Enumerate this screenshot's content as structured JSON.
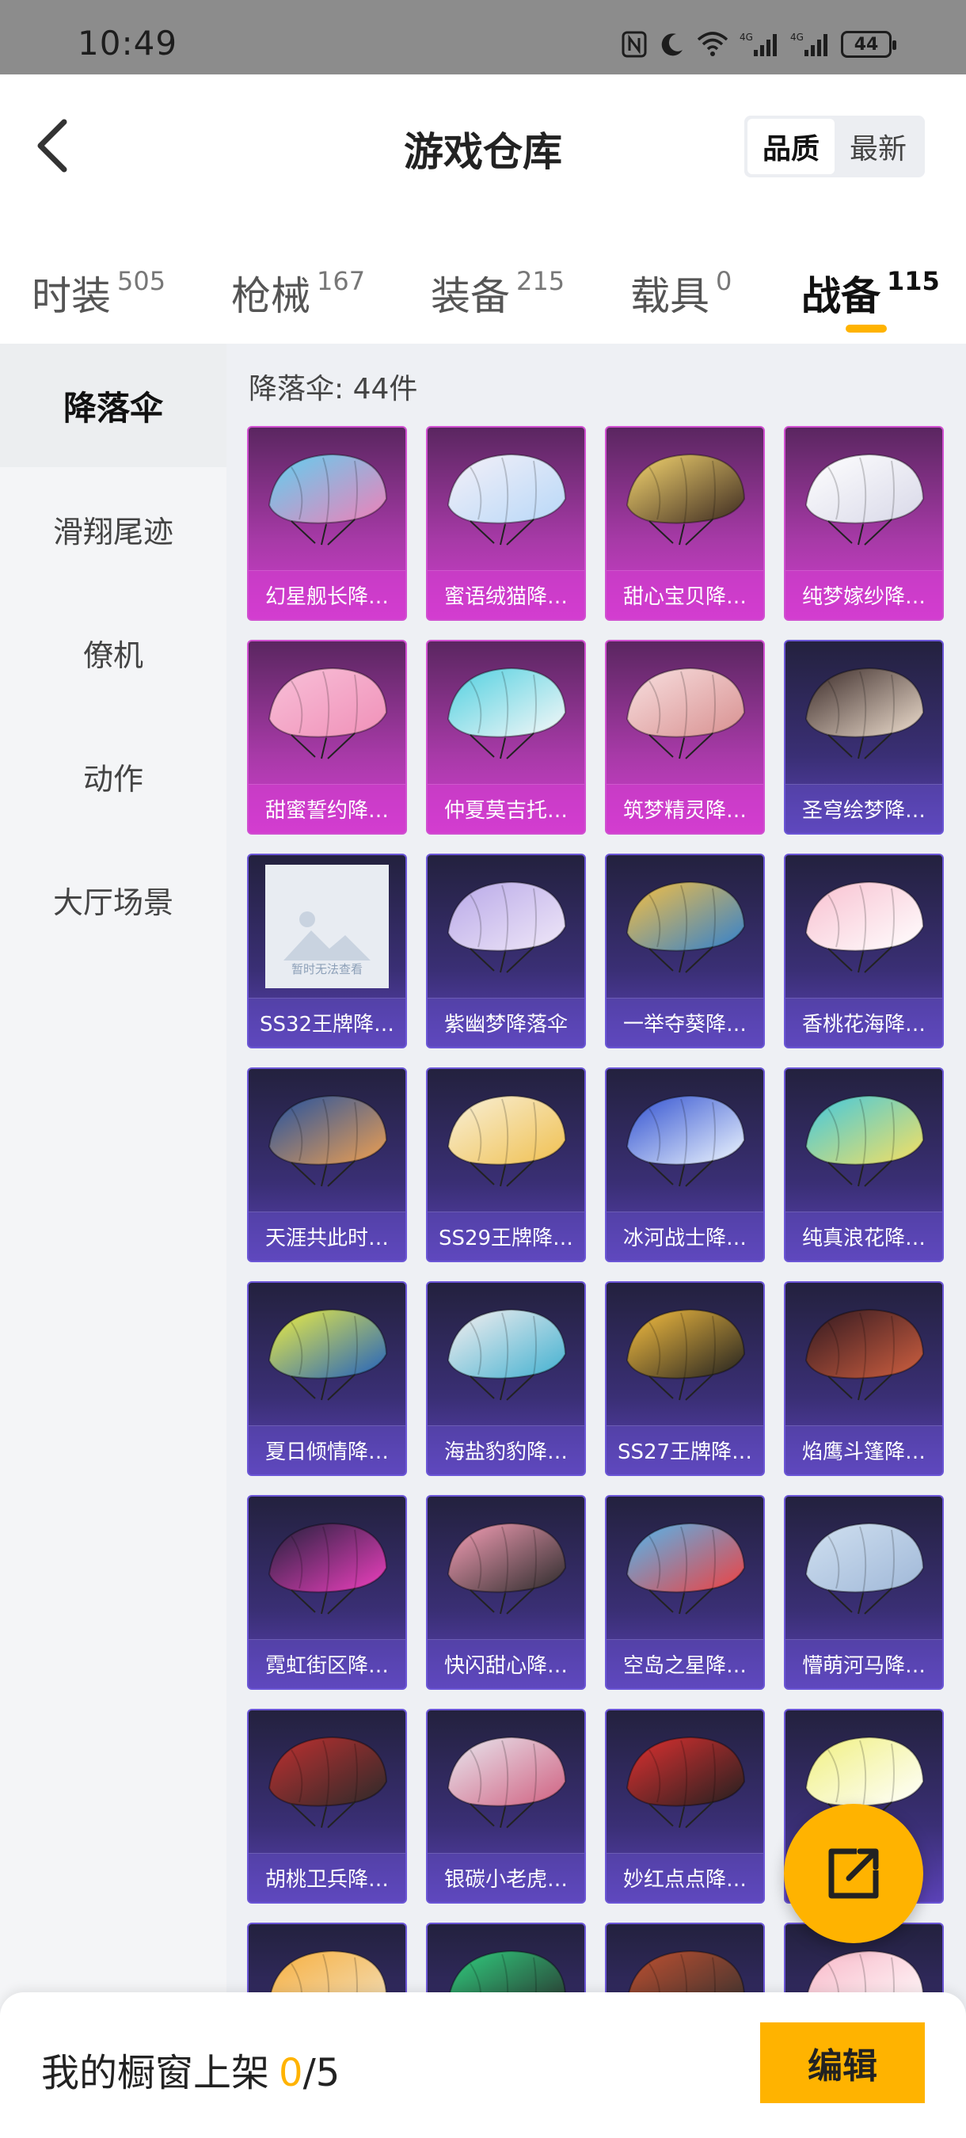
{
  "status_bar": {
    "time": "10:49",
    "battery": "44",
    "network": "4G"
  },
  "header": {
    "title": "游戏仓库",
    "sort_options": [
      "品质",
      "最新"
    ],
    "sort_active": "品质"
  },
  "tabs": [
    {
      "label": "时装",
      "count": "505"
    },
    {
      "label": "枪械",
      "count": "167"
    },
    {
      "label": "装备",
      "count": "215"
    },
    {
      "label": "载具",
      "count": "0"
    },
    {
      "label": "战备",
      "count": "115",
      "active": true
    }
  ],
  "sidebar": {
    "items": [
      "降落伞",
      "滑翔尾迹",
      "僚机",
      "动作",
      "大厅场景"
    ],
    "active": "降落伞"
  },
  "main": {
    "count_label": "降落伞: 44件",
    "placeholder_text": "暂时无法查看",
    "items": [
      {
        "name": "幻星舰长降…",
        "tier": "pink",
        "colors": [
          "#5fd0f0",
          "#f080b8"
        ]
      },
      {
        "name": "蜜语绒猫降…",
        "tier": "pink",
        "colors": [
          "#f4f0f8",
          "#b8d8f8"
        ]
      },
      {
        "name": "甜心宝贝降…",
        "tier": "pink",
        "colors": [
          "#f8d870",
          "#3a2820"
        ]
      },
      {
        "name": "纯梦嫁纱降…",
        "tier": "pink",
        "colors": [
          "#ffffff",
          "#d8d8e8"
        ]
      },
      {
        "name": "甜蜜誓约降…",
        "tier": "pink",
        "colors": [
          "#f8c0d8",
          "#f090b8"
        ]
      },
      {
        "name": "仲夏莫吉托…",
        "tier": "pink",
        "colors": [
          "#50d0e0",
          "#f8f8f8"
        ]
      },
      {
        "name": "筑梦精灵降…",
        "tier": "pink",
        "colors": [
          "#f8e0e0",
          "#d89090"
        ]
      },
      {
        "name": "圣穹绘梦降…",
        "tier": "purple",
        "colors": [
          "#3a2a28",
          "#f0e0d0"
        ]
      },
      {
        "name": "SS32王牌降…",
        "tier": "purple",
        "colors": [],
        "placeholder": true
      },
      {
        "name": "紫幽梦降落伞",
        "tier": "purple",
        "colors": [
          "#b8a8e8",
          "#f0e8f8"
        ]
      },
      {
        "name": "一举夺葵降…",
        "tier": "purple",
        "colors": [
          "#f8c040",
          "#3080d0"
        ]
      },
      {
        "name": "香桃花海降…",
        "tier": "purple",
        "colors": [
          "#f8c0d0",
          "#ffffff"
        ]
      },
      {
        "name": "天涯共此时…",
        "tier": "purple",
        "colors": [
          "#2050a0",
          "#f0a050"
        ]
      },
      {
        "name": "SS29王牌降…",
        "tier": "purple",
        "colors": [
          "#f8f0d8",
          "#f0c050"
        ]
      },
      {
        "name": "冰河战士降…",
        "tier": "purple",
        "colors": [
          "#3050d0",
          "#f0f8ff"
        ]
      },
      {
        "name": "纯真浪花降…",
        "tier": "purple",
        "colors": [
          "#40c8e0",
          "#f8e060"
        ]
      },
      {
        "name": "夏日倾情降…",
        "tier": "purple",
        "colors": [
          "#f0f040",
          "#2060c0"
        ]
      },
      {
        "name": "海盐豹豹降…",
        "tier": "purple",
        "colors": [
          "#f8f0f0",
          "#40b0d0"
        ]
      },
      {
        "name": "SS27王牌降…",
        "tier": "purple",
        "colors": [
          "#f8c040",
          "#202020"
        ]
      },
      {
        "name": "焰鹰斗篷降…",
        "tier": "purple",
        "colors": [
          "#301820",
          "#d06040"
        ]
      },
      {
        "name": "霓虹街区降…",
        "tier": "purple",
        "colors": [
          "#20203a",
          "#f040c0"
        ]
      },
      {
        "name": "快闪甜心降…",
        "tier": "purple",
        "colors": [
          "#f8a0b8",
          "#2a2a2a"
        ]
      },
      {
        "name": "空岛之星降…",
        "tier": "purple",
        "colors": [
          "#50b8f0",
          "#f04040"
        ]
      },
      {
        "name": "懵萌河马降…",
        "tier": "purple",
        "colors": [
          "#d0e0f0",
          "#a0b8d8"
        ]
      },
      {
        "name": "胡桃卫兵降…",
        "tier": "purple",
        "colors": [
          "#c03030",
          "#2a2a2a"
        ]
      },
      {
        "name": "银碳小老虎…",
        "tier": "purple",
        "colors": [
          "#e8e8f0",
          "#d06080"
        ]
      },
      {
        "name": "妙红点点降…",
        "tier": "purple",
        "colors": [
          "#e03030",
          "#202020"
        ]
      },
      {
        "name": "",
        "tier": "purple",
        "colors": [
          "#f0f080",
          "#ffffff"
        ]
      },
      {
        "name": "",
        "tier": "purple",
        "colors": [
          "#f8b040",
          "#f0e0c0"
        ]
      },
      {
        "name": "",
        "tier": "purple",
        "colors": [
          "#30d080",
          "#2a2a2a"
        ]
      },
      {
        "name": "",
        "tier": "purple",
        "colors": [
          "#c05030",
          "#303030"
        ]
      },
      {
        "name": "",
        "tier": "purple",
        "colors": [
          "#f8b8c8",
          "#ffffff"
        ]
      }
    ]
  },
  "bottom_bar": {
    "label": "我的橱窗上架",
    "current": "0",
    "total": "/5",
    "edit_label": "编辑"
  }
}
